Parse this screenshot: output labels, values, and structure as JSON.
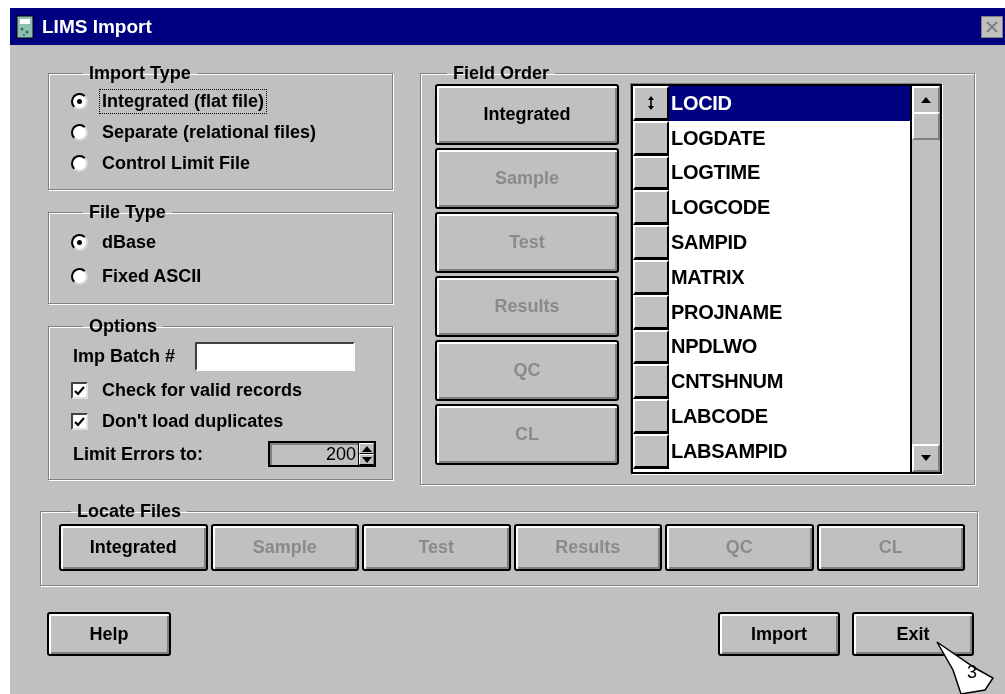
{
  "window": {
    "title": "LIMS Import",
    "close_disabled": true
  },
  "import_type": {
    "title": "Import Type",
    "options": [
      {
        "label": "Integrated (flat file)",
        "selected": true,
        "focused": true
      },
      {
        "label": "Separate (relational files)",
        "selected": false,
        "focused": false
      },
      {
        "label": "Control Limit File",
        "selected": false,
        "focused": false
      }
    ]
  },
  "file_type": {
    "title": "File Type",
    "options": [
      {
        "label": "dBase",
        "selected": true
      },
      {
        "label": "Fixed ASCII",
        "selected": false
      }
    ]
  },
  "options": {
    "title": "Options",
    "batch_label": "Imp Batch #",
    "checkboxes": [
      {
        "label": "Check for valid records",
        "checked": true
      },
      {
        "label": "Don't load duplicates",
        "checked": true
      }
    ],
    "limit_label": "Limit Errors to:",
    "limit_value": "200"
  },
  "field_order": {
    "title": "Field Order",
    "buttons": [
      {
        "label": "Integrated",
        "disabled": false
      },
      {
        "label": "Sample",
        "disabled": true
      },
      {
        "label": "Test",
        "disabled": true
      },
      {
        "label": "Results",
        "disabled": true
      },
      {
        "label": "QC",
        "disabled": true
      },
      {
        "label": "CL",
        "disabled": true
      }
    ],
    "fields": [
      {
        "name": "LOCID",
        "selected": true
      },
      {
        "name": "LOGDATE",
        "selected": false
      },
      {
        "name": "LOGTIME",
        "selected": false
      },
      {
        "name": "LOGCODE",
        "selected": false
      },
      {
        "name": "SAMPID",
        "selected": false
      },
      {
        "name": "MATRIX",
        "selected": false
      },
      {
        "name": "PROJNAME",
        "selected": false
      },
      {
        "name": "NPDLWO",
        "selected": false
      },
      {
        "name": "CNTSHNUM",
        "selected": false
      },
      {
        "name": "LABCODE",
        "selected": false
      },
      {
        "name": "LABSAMPID",
        "selected": false
      }
    ]
  },
  "locate_files": {
    "title": "Locate Files",
    "buttons": [
      {
        "label": "Integrated",
        "disabled": false
      },
      {
        "label": "Sample",
        "disabled": true
      },
      {
        "label": "Test",
        "disabled": true
      },
      {
        "label": "Results",
        "disabled": true
      },
      {
        "label": "QC",
        "disabled": true
      },
      {
        "label": "CL",
        "disabled": true
      }
    ]
  },
  "footer": {
    "left_buttons": [
      {
        "label": "Help"
      }
    ],
    "right_buttons": [
      {
        "label": "Import"
      },
      {
        "label": "Exit"
      }
    ]
  },
  "callout": {
    "number": "3"
  }
}
